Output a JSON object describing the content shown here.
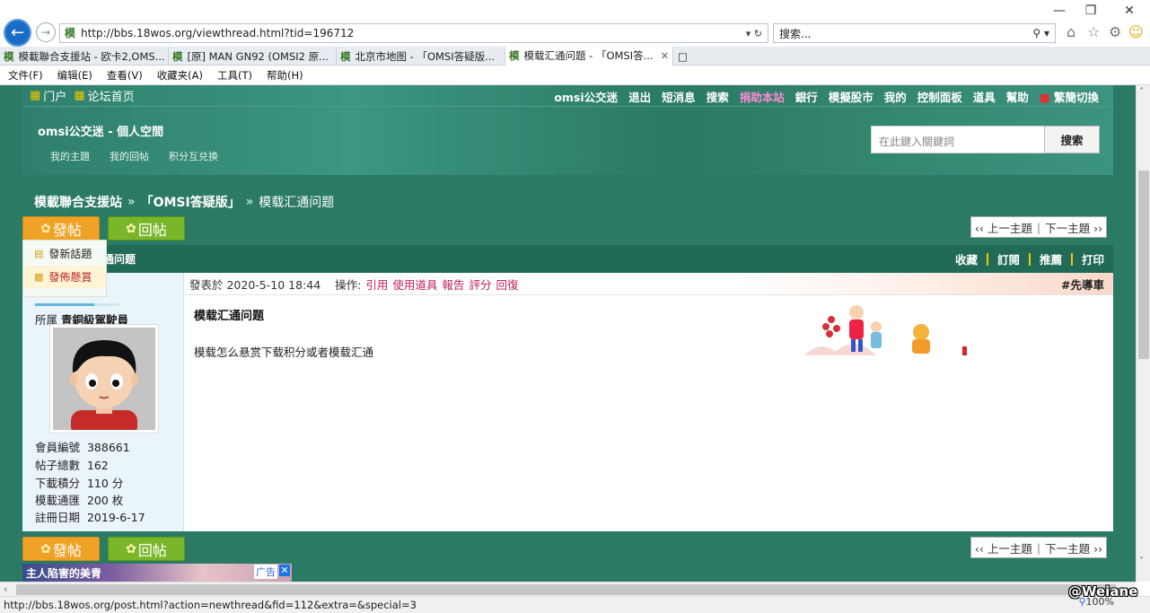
{
  "window": {
    "minimize": "—",
    "restore": "❐",
    "close": "✕"
  },
  "address": {
    "url": "http://bbs.18wos.org/viewthread.html?tid=196712",
    "tools": "▾ ↻"
  },
  "search": {
    "placeholder": "搜索...",
    "icon": "⚲ ▾"
  },
  "tabs": [
    {
      "label": "模載聯合支援站 - 欧卡2,OMS..."
    },
    {
      "label": "[原] MAN GN92 (OMSI2 原..."
    },
    {
      "label": "北京市地图 - 「OMSI答疑版..."
    },
    {
      "label": "模载汇通问题 - 「OMSI答..."
    }
  ],
  "menu": [
    "文件(F)",
    "编辑(E)",
    "查看(V)",
    "收藏夹(A)",
    "工具(T)",
    "帮助(H)"
  ],
  "topnav": {
    "portal": "门户",
    "home": "论坛首页",
    "right": [
      "omsi公交迷",
      "退出",
      "短消息",
      "搜索",
      "捐助本站",
      "銀行",
      "模擬股市",
      "我的",
      "控制面板",
      "道具",
      "幫助",
      "繁簡切換"
    ]
  },
  "space": {
    "title": "omsi公交迷 - 個人空間",
    "links": [
      "我的主題",
      "我的回帖",
      "积分互兑换"
    ]
  },
  "kw": {
    "placeholder": "在此鍵入關鍵詞",
    "button": "搜索"
  },
  "breadcrumb": {
    "site": "模載聯合支援站",
    "sep1": "»",
    "forum": "「OMSI答疑版」",
    "sep2": "»",
    "thread": "模载汇通问题"
  },
  "buttons": {
    "post": "發帖",
    "reply": "回帖"
  },
  "pager": {
    "prev": "‹‹ 上一主題",
    "sep": "|",
    "next": "下一主題 ››"
  },
  "dropdown": {
    "new_topic": "發新話題",
    "bounty": "發佈懸賞"
  },
  "threadbar": {
    "title": "通问题",
    "actions": [
      "收藏",
      "訂閱",
      "推薦",
      "打印"
    ]
  },
  "user": {
    "rank_prefix": "所属",
    "rank": "青銅級駕駛員",
    "stats": [
      {
        "k": "會員編號",
        "v": "388661"
      },
      {
        "k": "帖子總數",
        "v": "162"
      },
      {
        "k": "下載積分",
        "v": "110 分"
      },
      {
        "k": "模載通匯",
        "v": "200 枚"
      },
      {
        "k": "註冊日期",
        "v": "2019-6-17"
      }
    ]
  },
  "post": {
    "date": "發表於 2020-5-10 18:44",
    "op_label": "操作:",
    "ops": [
      "引用",
      "使用道具",
      "報告",
      "評分",
      "回復"
    ],
    "floor": "#先導車",
    "title": "模载汇通问题",
    "body": "模载怎么悬赏下载积分或者模载汇通"
  },
  "ad": {
    "text": "主人陷害的美青",
    "label": "广告",
    "close": "✕"
  },
  "status": {
    "url": "http://bbs.18wos.org/post.html?action=newthread&fid=112&extra=&special=3",
    "zoom": "100%"
  },
  "watermark": "@Weiane",
  "colors": {
    "bg": "#2b7a65",
    "threadbar": "#226a58",
    "orange": "#f0a226",
    "green": "#7ab62a",
    "link_pink": "#c0205b"
  }
}
